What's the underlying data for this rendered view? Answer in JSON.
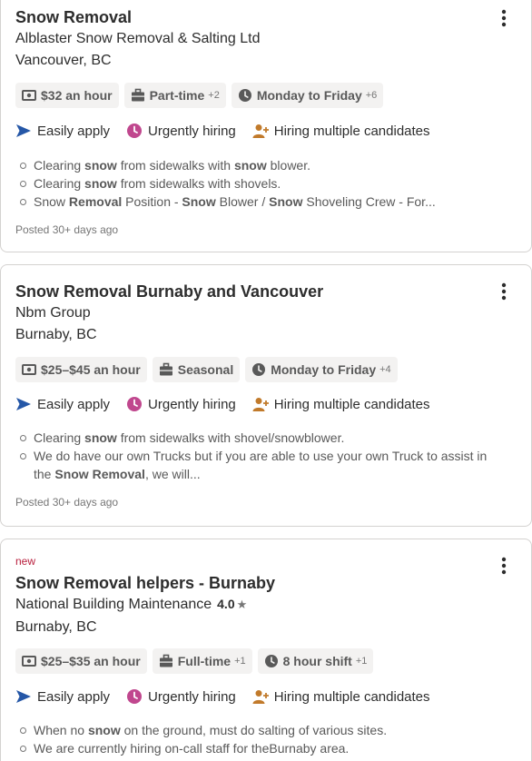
{
  "colors": {
    "accent_blue": "#2557a7",
    "urgent_purple": "#c0478e",
    "hiring_orange": "#c17a2b",
    "new_red": "#b9203e"
  },
  "jobs": [
    {
      "title": "Snow Removal",
      "company": "Alblaster Snow Removal & Salting Ltd",
      "location": "Vancouver, BC",
      "chips": [
        {
          "icon": "money-icon",
          "label": "$32 an hour",
          "extra": ""
        },
        {
          "icon": "briefcase-icon",
          "label": "Part-time",
          "extra": "+2"
        },
        {
          "icon": "clock-icon",
          "label": "Monday to Friday",
          "extra": "+6"
        }
      ],
      "attributes": [
        "Easily apply",
        "Urgently hiring",
        "Hiring multiple candidates"
      ],
      "snippet": [
        [
          {
            "t": "Clearing "
          },
          {
            "t": "snow",
            "b": true
          },
          {
            "t": " from sidewalks with "
          },
          {
            "t": "snow",
            "b": true
          },
          {
            "t": " blower."
          }
        ],
        [
          {
            "t": "Clearing "
          },
          {
            "t": "snow",
            "b": true
          },
          {
            "t": " from sidewalks with shovels."
          }
        ],
        [
          {
            "t": "Snow "
          },
          {
            "t": "Removal",
            "b": true
          },
          {
            "t": " Position - "
          },
          {
            "t": "Snow",
            "b": true
          },
          {
            "t": " Blower / "
          },
          {
            "t": "Snow",
            "b": true
          },
          {
            "t": " Shoveling Crew - For..."
          }
        ]
      ],
      "posted": "Posted 30+ days ago"
    },
    {
      "title": "Snow Removal Burnaby and Vancouver",
      "company": "Nbm Group",
      "location": "Burnaby, BC",
      "chips": [
        {
          "icon": "money-icon",
          "label": "$25–$45 an hour",
          "extra": ""
        },
        {
          "icon": "briefcase-icon",
          "label": "Seasonal",
          "extra": ""
        },
        {
          "icon": "clock-icon",
          "label": "Monday to Friday",
          "extra": "+4"
        }
      ],
      "attributes": [
        "Easily apply",
        "Urgently hiring",
        "Hiring multiple candidates"
      ],
      "snippet": [
        [
          {
            "t": "Clearing "
          },
          {
            "t": "snow",
            "b": true
          },
          {
            "t": " from sidewalks with shovel/snowblower."
          }
        ],
        [
          {
            "t": "We do have our own Trucks but if you are able to use your own Truck to assist in the "
          },
          {
            "t": "Snow Removal",
            "b": true
          },
          {
            "t": ", we will..."
          }
        ]
      ],
      "posted": "Posted 30+ days ago"
    },
    {
      "badge": "new",
      "title": "Snow Removal helpers - Burnaby",
      "company": "National Building Maintenance",
      "rating": "4.0",
      "location": "Burnaby, BC",
      "chips": [
        {
          "icon": "money-icon",
          "label": "$25–$35 an hour",
          "extra": ""
        },
        {
          "icon": "briefcase-icon",
          "label": "Full-time",
          "extra": "+1"
        },
        {
          "icon": "clock-icon",
          "label": "8 hour shift",
          "extra": "+1"
        }
      ],
      "attributes": [
        "Easily apply",
        "Urgently hiring",
        "Hiring multiple candidates"
      ],
      "snippet": [
        [
          {
            "t": "When no "
          },
          {
            "t": "snow",
            "b": true
          },
          {
            "t": " on the ground, must do salting of various sites."
          }
        ],
        [
          {
            "t": "We are currently hiring on-call staff for theBurnaby area."
          }
        ]
      ],
      "posted": ""
    }
  ]
}
